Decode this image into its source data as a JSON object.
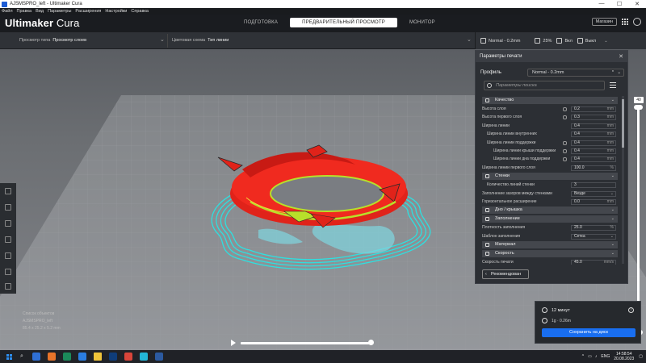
{
  "window": {
    "title": "AJSMSPRO_left - Ultimaker Cura",
    "controls": [
      "—",
      "☐",
      "✕"
    ]
  },
  "menu": [
    "Файл",
    "Правка",
    "Вид",
    "Параметры",
    "Расширения",
    "Настройки",
    "Справка"
  ],
  "header": {
    "logo_bold": "Ultimaker",
    "logo_thin": " Cura",
    "stages": [
      "ПОДГОТОВКА",
      "ПРЕДВАРИТЕЛЬНЫЙ ПРОСМОТР",
      "МОНИТОР"
    ],
    "market_label": "Магазин"
  },
  "viewbar": {
    "view_type_label": "Просмотр типа",
    "view_type_value": "Просмотр слоев",
    "color_scheme_label": "Цветовая схема",
    "color_scheme_value": "Тип линии"
  },
  "printbar": {
    "profile": "Normal - 0.2mm",
    "infill": "25%",
    "support": "Вкл",
    "adhesion": "Выкл"
  },
  "panel": {
    "title": "Параметры печати",
    "profile_label": "Профиль",
    "profile_value": "Normal - 0.2mm",
    "profile_mark": "*",
    "search_placeholder": "Параметры поиска",
    "recommended_label": "Рекомендован",
    "rows": [
      {
        "kind": "cat",
        "label": "Качество"
      },
      {
        "kind": "set",
        "label": "Высота слоя",
        "value": "0.2",
        "unit": "mm",
        "link": true,
        "indent": 0
      },
      {
        "kind": "set",
        "label": "Высота первого слоя",
        "value": "0.3",
        "unit": "mm",
        "link": true,
        "indent": 0
      },
      {
        "kind": "set",
        "label": "Ширина линии",
        "value": "0.4",
        "unit": "mm",
        "link": false,
        "indent": 0
      },
      {
        "kind": "set",
        "label": "Ширина линии внутренних",
        "value": "0.4",
        "unit": "mm",
        "link": false,
        "indent": 1
      },
      {
        "kind": "set",
        "label": "Ширина линии поддержки",
        "value": "0.4",
        "unit": "mm",
        "link": true,
        "indent": 1
      },
      {
        "kind": "set",
        "label": "Ширина линии крыши поддержки",
        "value": "0.4",
        "unit": "mm",
        "link": true,
        "indent": 2
      },
      {
        "kind": "set",
        "label": "Ширина линии дна поддержки",
        "value": "0.4",
        "unit": "mm",
        "link": true,
        "indent": 2
      },
      {
        "kind": "set",
        "label": "Ширина линии первого слоя",
        "value": "100.0",
        "unit": "%",
        "link": false,
        "indent": 0
      },
      {
        "kind": "cat",
        "label": "Стенки"
      },
      {
        "kind": "set",
        "label": "Количество линий стенки",
        "value": "3",
        "unit": "",
        "link": false,
        "indent": 1
      },
      {
        "kind": "set",
        "label": "Заполнение зазоров между стенками",
        "value": "Везде",
        "unit": "",
        "link": false,
        "indent": 0,
        "dropdown": true
      },
      {
        "kind": "set",
        "label": "Горизонтальное расширение",
        "value": "0.0",
        "unit": "mm",
        "link": false,
        "indent": 0
      },
      {
        "kind": "cat",
        "label": "Дно / крышка"
      },
      {
        "kind": "cat",
        "label": "Заполнение"
      },
      {
        "kind": "set",
        "label": "Плотность заполнения",
        "value": "25.0",
        "unit": "%",
        "link": false,
        "indent": 0
      },
      {
        "kind": "set",
        "label": "Шаблон заполнения",
        "value": "Сетка",
        "unit": "",
        "link": false,
        "indent": 0,
        "dropdown": true
      },
      {
        "kind": "cat",
        "label": "Материал"
      },
      {
        "kind": "cat",
        "label": "Скорость"
      },
      {
        "kind": "set",
        "label": "Скорость печати",
        "value": "45.0",
        "unit": "mm/s",
        "link": false,
        "indent": 0
      }
    ]
  },
  "layer_slider": {
    "value": "40",
    "progress": 1.0
  },
  "playback": {
    "progress": 1.0
  },
  "objects": {
    "title": "Список объектов",
    "name": "AJSMSPRO_left",
    "size": "85.4 x 25.2 x 5.2 mm"
  },
  "print_info": {
    "time": "12 минут",
    "material": "1g · 0.26m",
    "save_label": "Сохранить на диск"
  },
  "taskbar": {
    "lang": "ENG",
    "time": "14:58:54",
    "date": "20.08.2023",
    "apps": [
      "#2f6fd4",
      "#e8742a",
      "#1b8a5a",
      "#2b7de0",
      "#f0c43a",
      "#0f3d7a",
      "#d8453a",
      "#23b6d8",
      "#2c5aa0"
    ]
  }
}
